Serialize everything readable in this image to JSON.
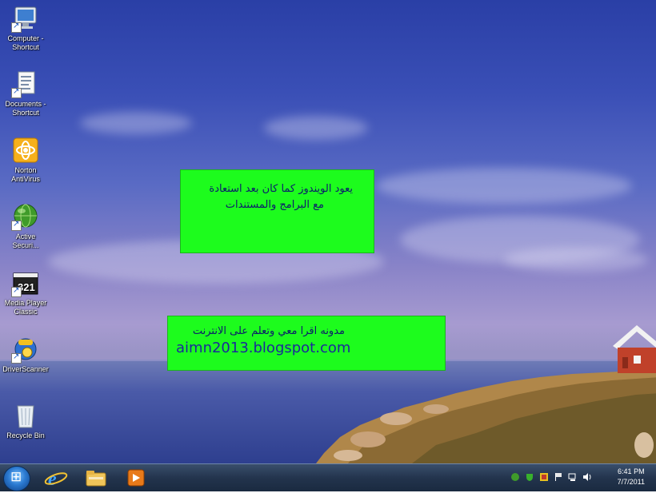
{
  "desktop": {
    "icons": [
      {
        "label": "Computer -\nShortcut",
        "icon": "computer-icon"
      },
      {
        "label": "Documents -\nShortcut",
        "icon": "documents-icon"
      },
      {
        "label": "Norton\nAntiVirus",
        "icon": "norton-icon"
      },
      {
        "label": "Active\nSecuri...",
        "icon": "globe-icon"
      },
      {
        "label": "Media Player\nClassic",
        "icon": "media-player-icon"
      },
      {
        "label": "DriverScanner",
        "icon": "driverscanner-icon"
      },
      {
        "label": "Recycle Bin",
        "icon": "recycle-bin-icon"
      }
    ]
  },
  "notes": {
    "note1_line1": "يعود الويندوز كما كان بعد استعادة",
    "note1_line2": "مع البرامج والمستندات",
    "note2_line1": "مدونه اقرا معي وتعلم على الانترنت",
    "note2_url": "aimn2013.blogspot.com"
  },
  "taskbar": {
    "pinned": [
      "internet-explorer-icon",
      "windows-explorer-icon",
      "media-player-icon"
    ],
    "clock_time": "6:41 PM",
    "clock_date": "7/7/2011"
  },
  "colors": {
    "note_bg": "#1dfc1d",
    "note_text": "#0b1a6b"
  }
}
